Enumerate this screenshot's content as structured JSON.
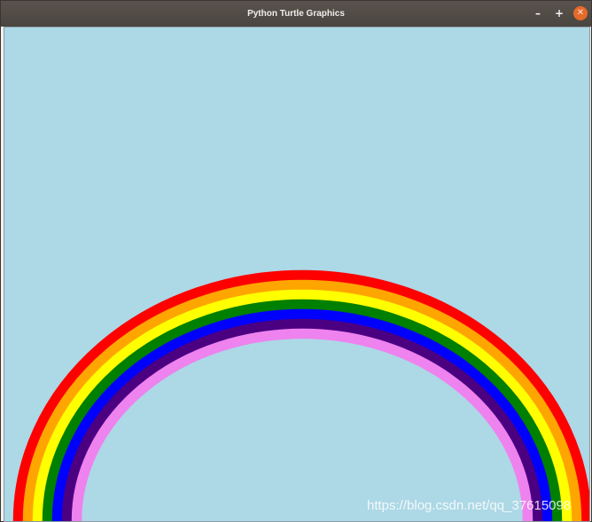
{
  "window": {
    "title": "Python Turtle Graphics",
    "buttons": {
      "minimize": "–",
      "maximize": "+",
      "close": "✕"
    }
  },
  "canvas": {
    "background": "#add8e6",
    "rainbow_colors": [
      "#ff0000",
      "#ffa500",
      "#ffff00",
      "#008000",
      "#0000ff",
      "#4b0082",
      "#ee82ee"
    ]
  },
  "watermark": "https://blog.csdn.net/qq_37615098"
}
